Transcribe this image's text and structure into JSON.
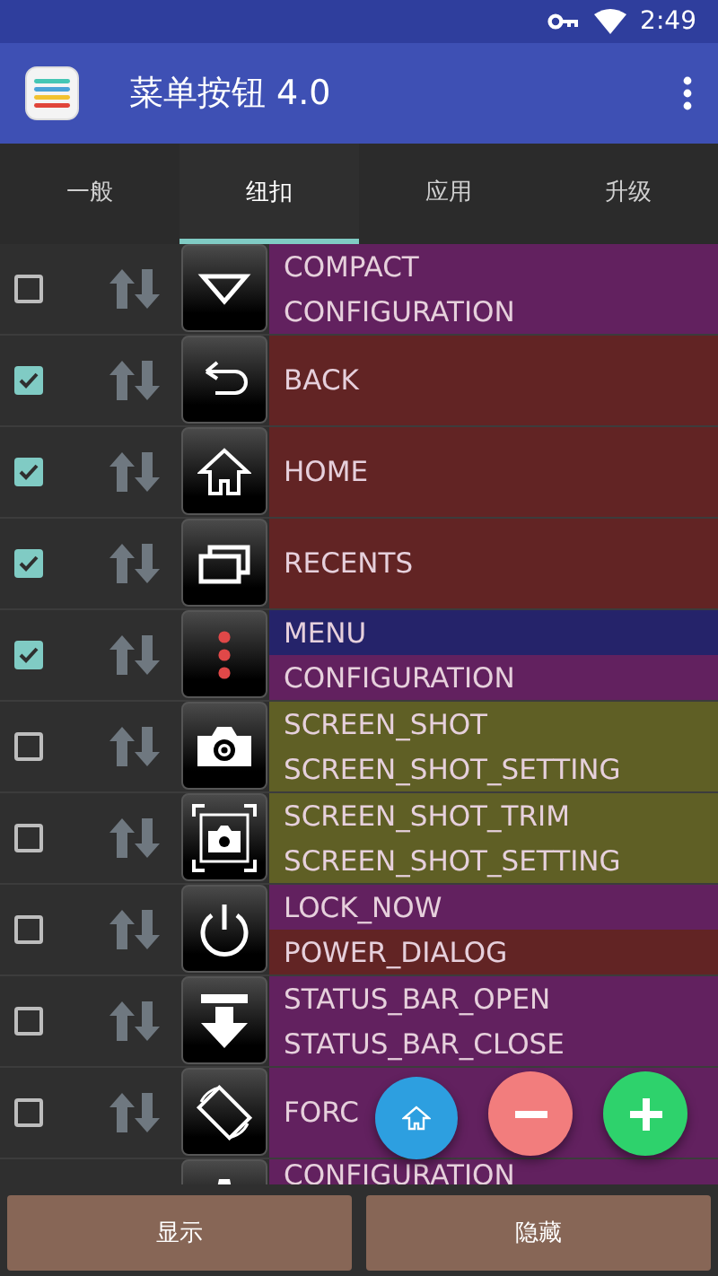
{
  "status_bar": {
    "time": "2:49"
  },
  "app_bar": {
    "title": "菜单按钮 4.0"
  },
  "tabs": [
    {
      "label": "一般",
      "selected": false
    },
    {
      "label": "纽扣",
      "selected": true
    },
    {
      "label": "应用",
      "selected": false
    },
    {
      "label": "升级",
      "selected": false
    }
  ],
  "rows": [
    {
      "checked": false,
      "actions": [
        {
          "label": "COMPACT",
          "color": "#62215f"
        },
        {
          "label": "CONFIGURATION",
          "color": "#62215f"
        }
      ]
    },
    {
      "checked": true,
      "actions": [
        {
          "label": "BACK",
          "color": "#622424"
        }
      ]
    },
    {
      "checked": true,
      "actions": [
        {
          "label": "HOME",
          "color": "#622424"
        }
      ]
    },
    {
      "checked": true,
      "actions": [
        {
          "label": "RECENTS",
          "color": "#622424"
        }
      ]
    },
    {
      "checked": true,
      "actions": [
        {
          "label": "MENU",
          "color": "#25236a"
        },
        {
          "label": "CONFIGURATION",
          "color": "#62215f"
        }
      ]
    },
    {
      "checked": false,
      "actions": [
        {
          "label": "SCREEN_SHOT",
          "color": "#5f5f25"
        },
        {
          "label": "SCREEN_SHOT_SETTING",
          "color": "#5f5f25"
        }
      ]
    },
    {
      "checked": false,
      "actions": [
        {
          "label": "SCREEN_SHOT_TRIM",
          "color": "#5f5f25"
        },
        {
          "label": "SCREEN_SHOT_SETTING",
          "color": "#5f5f25"
        }
      ]
    },
    {
      "checked": false,
      "actions": [
        {
          "label": "LOCK_NOW",
          "color": "#62215f"
        },
        {
          "label": "POWER_DIALOG",
          "color": "#622424"
        }
      ]
    },
    {
      "checked": false,
      "actions": [
        {
          "label": "STATUS_BAR_OPEN",
          "color": "#62215f"
        },
        {
          "label": "STATUS_BAR_CLOSE",
          "color": "#62215f"
        }
      ]
    },
    {
      "checked": false,
      "actions": [
        {
          "label": "FORC",
          "color": "#62215f"
        }
      ]
    },
    {
      "actions": [
        {
          "label": "CONFIGURATION",
          "color": "#62215f"
        }
      ]
    }
  ],
  "buttons": [
    {
      "label": "显示"
    },
    {
      "label": "隐藏"
    }
  ]
}
